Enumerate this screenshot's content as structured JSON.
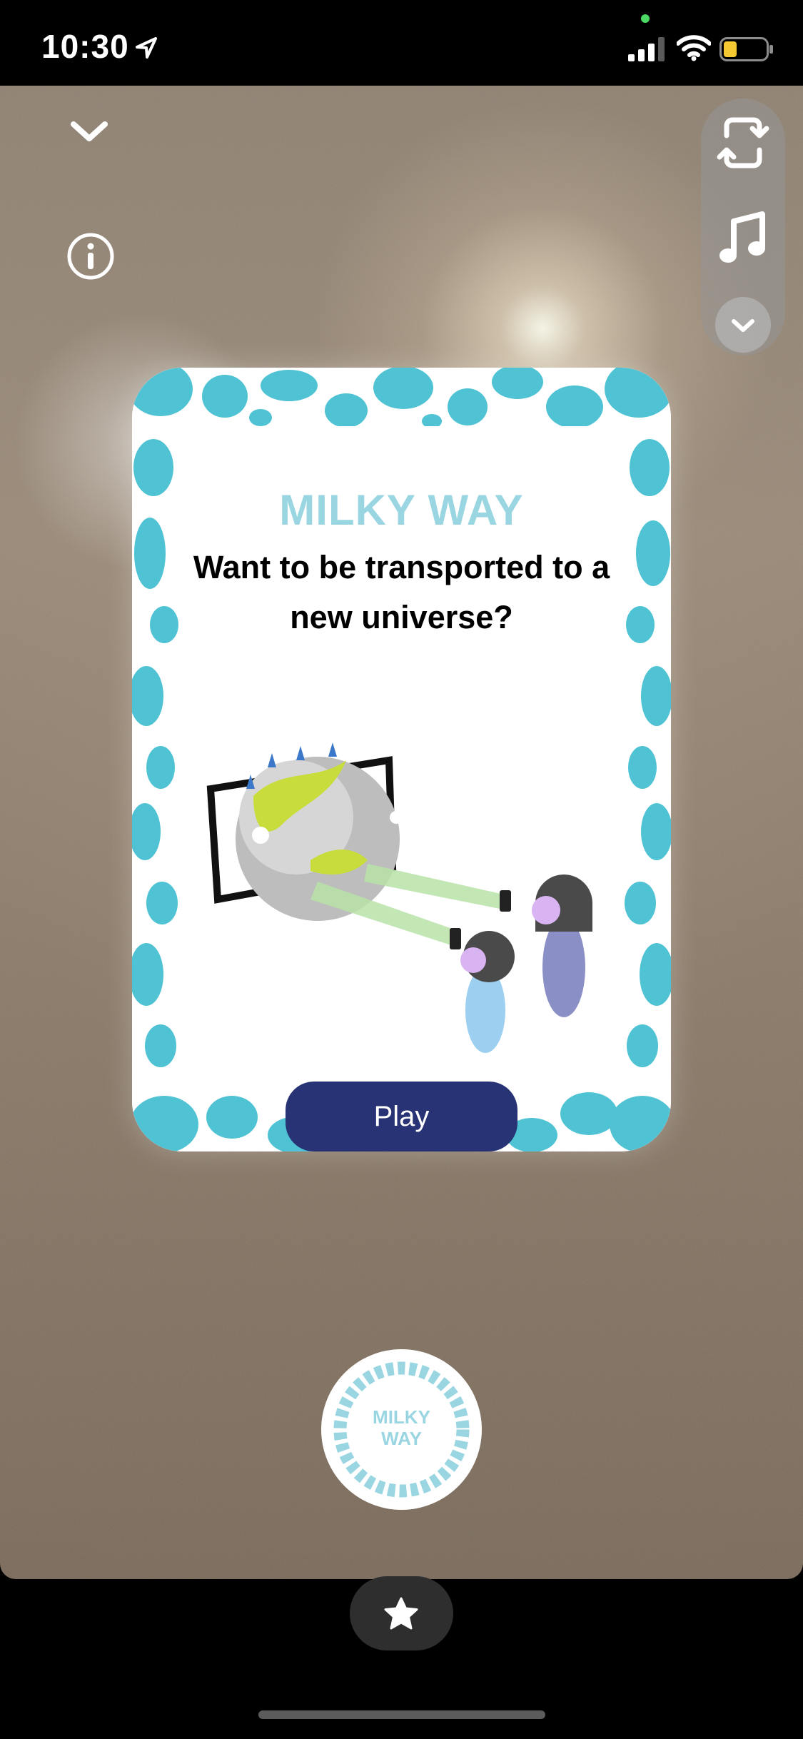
{
  "status_bar": {
    "time": "10:30"
  },
  "card": {
    "title": "MILKY WAY",
    "headline": "Want to be transported to a new universe?",
    "play_label": "Play"
  },
  "lens_button": {
    "line1": "MILKY",
    "line2": "WAY"
  },
  "colors": {
    "accent_blue": "#4fc3d4",
    "title_blue": "#9ad6e2",
    "play_button": "#283375",
    "pill_bg": "#969696"
  },
  "icons": [
    "chevron-down-icon",
    "info-icon",
    "camera-flip-icon",
    "music-note-icon",
    "chevron-down-circle-icon",
    "star-icon",
    "location-arrow-icon",
    "signal-icon",
    "wifi-icon",
    "battery-icon"
  ]
}
